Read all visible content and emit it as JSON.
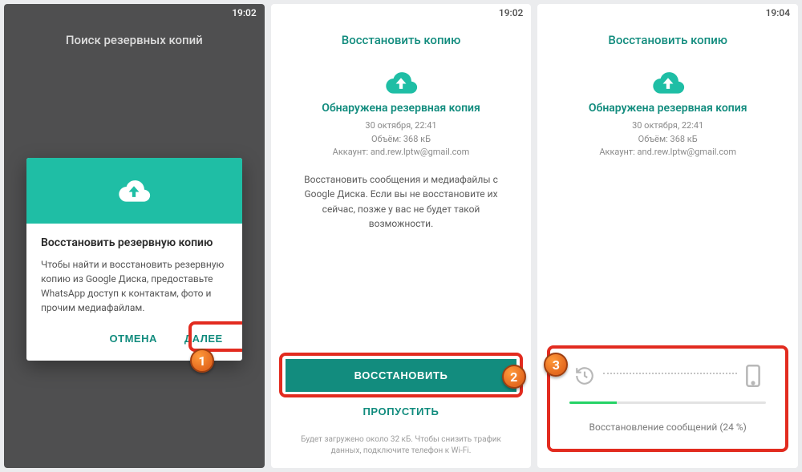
{
  "screen1": {
    "time": "19:02",
    "title": "Поиск резервных копий",
    "dialog": {
      "title": "Восстановить резервную копию",
      "body": "Чтобы найти и восстановить резервную копию из Google Диска, предоставьте WhatsApp доступ к контактам, фото и прочим медиафайлам.",
      "cancel": "ОТМЕНА",
      "next": "ДАЛЕЕ"
    },
    "badge": "1"
  },
  "screen2": {
    "time": "19:02",
    "title": "Восстановить копию",
    "found": "Обнаружена резервная копия",
    "date": "30 октября, 22:41",
    "size": "Объём: 368 кБ",
    "account": "Аккаунт: and.rew.lptw@gmail.com",
    "desc": "Восстановить сообщения и медиафайлы с Google Диска. Если вы не восстановите их сейчас, позже у вас не будет такой возможности.",
    "restore": "ВОССТАНОВИТЬ",
    "skip": "ПРОПУСТИТЬ",
    "hint": "Будет загружено около 32 кБ. Чтобы снизить трафик данных, подключите телефон к Wi-Fi.",
    "badge": "2"
  },
  "screen3": {
    "time": "19:04",
    "title": "Восстановить копию",
    "found": "Обнаружена резервная копия",
    "date": "30 октября, 22:41",
    "size": "Объём: 368 кБ",
    "account": "Аккаунт: and.rew.lptw@gmail.com",
    "progress_pct": 24,
    "progress_label": "Восстановление сообщений (24 %)",
    "badge": "3"
  }
}
